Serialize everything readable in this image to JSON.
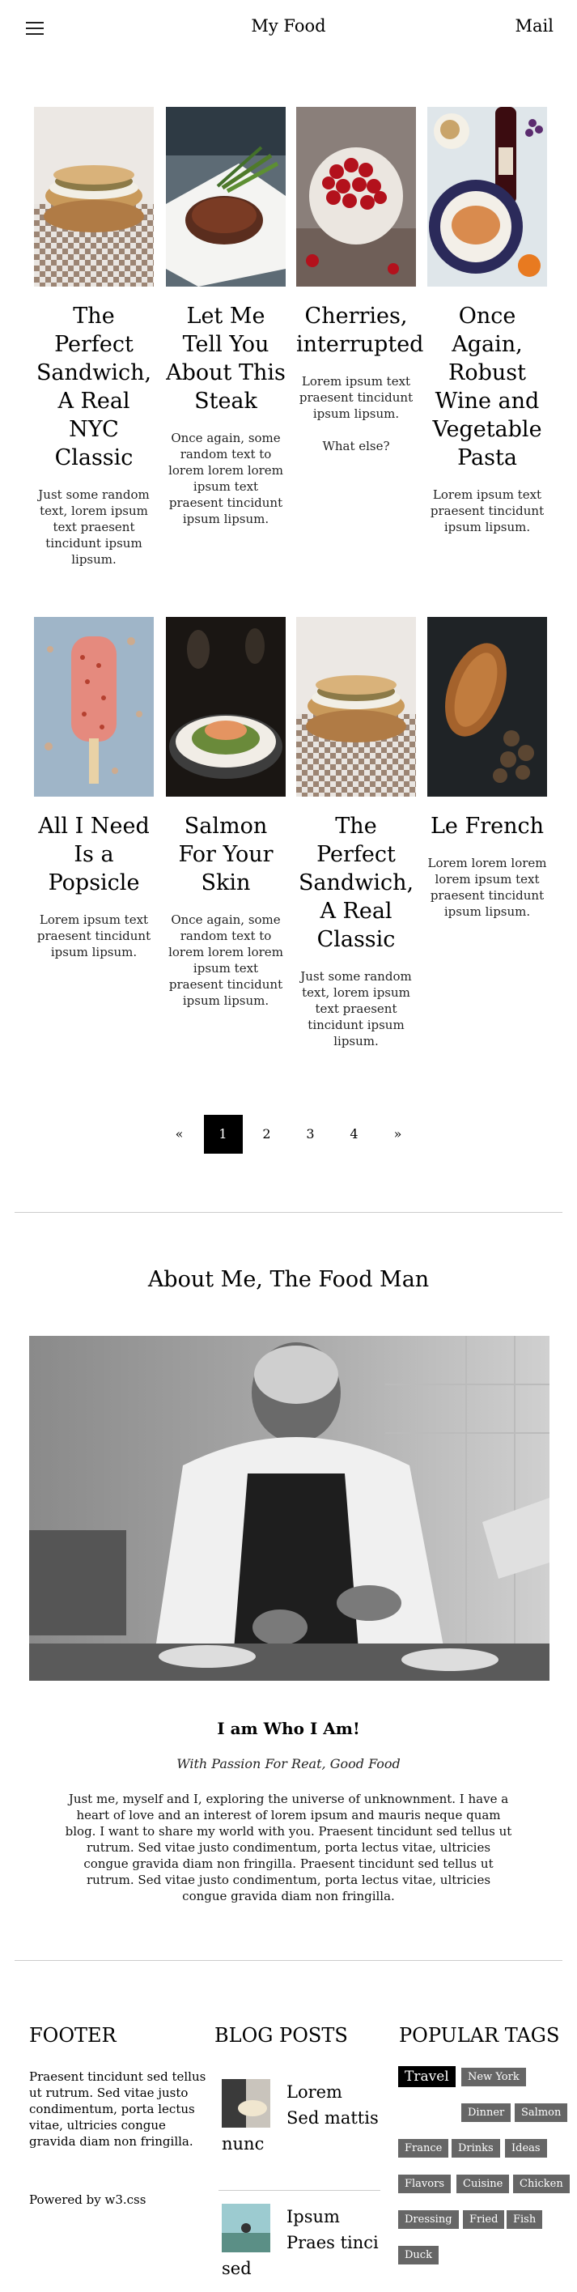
{
  "header": {
    "menu_icon": "hamburger-menu-icon",
    "title": "My Food",
    "mail": "Mail"
  },
  "cards": [
    {
      "title": "The Perfect Sandwich, A Real NYC Classic",
      "text": "Just some random text, lorem ipsum text praesent tincidunt ipsum lipsum.",
      "extra": ""
    },
    {
      "title": "Let Me Tell You About This Steak",
      "text": "Once again, some random text to lorem lorem lorem ipsum text praesent tincidunt ipsum lipsum.",
      "extra": ""
    },
    {
      "title": "Cherries, interrupted",
      "text": "Lorem ipsum text praesent tincidunt ipsum lipsum.",
      "extra": "What else?"
    },
    {
      "title": "Once Again, Robust Wine and Vegetable Pasta",
      "text": "Lorem ipsum text praesent tincidunt ipsum lipsum.",
      "extra": ""
    },
    {
      "title": "All I Need Is a Popsicle",
      "text": "Lorem ipsum text praesent tincidunt ipsum lipsum.",
      "extra": ""
    },
    {
      "title": "Salmon For Your Skin",
      "text": "Once again, some random text to lorem lorem lorem ipsum text praesent tincidunt ipsum lipsum.",
      "extra": ""
    },
    {
      "title": "The Perfect Sandwich, A Real Classic",
      "text": "Just some random text, lorem ipsum text praesent tincidunt ipsum lipsum.",
      "extra": ""
    },
    {
      "title": "Le French",
      "text": "Lorem lorem lorem lorem ipsum text praesent tincidunt ipsum lipsum.",
      "extra": ""
    }
  ],
  "pagination": {
    "prev": "«",
    "pages": [
      "1",
      "2",
      "3",
      "4"
    ],
    "next": "»",
    "active": "1"
  },
  "about": {
    "title": "About Me, The Food Man",
    "name": "I am Who I Am!",
    "tagline": "With Passion For Reat, Good Food",
    "body": "Just me, myself and I, exploring the universe of unknownment. I have a heart of love and an interest of lorem ipsum and mauris neque quam blog. I want to share my world with you. Praesent tincidunt sed tellus ut rutrum. Sed vitae justo condimentum, porta lectus vitae, ultricies congue gravida diam non fringilla. Praesent tincidunt sed tellus ut rutrum. Sed vitae justo condimentum, porta lectus vitae, ultricies congue gravida diam non fringilla."
  },
  "footer": {
    "heading": "FOOTER",
    "text": "Praesent tincidunt sed tellus ut rutrum. Sed vitae justo condimentum, porta lectus vitae, ultricies congue gravida diam non fringilla.",
    "powered_prefix": "Powered by ",
    "powered_link": "w3.css"
  },
  "blog_posts": {
    "heading": "BLOG POSTS",
    "posts": [
      {
        "line1": "Lorem",
        "line2": "Sed mattis",
        "line3": "nunc"
      },
      {
        "line1": "Ipsum",
        "line2": "Praes tinci",
        "line3": "sed"
      }
    ]
  },
  "popular_tags": {
    "heading": "POPULAR TAGS",
    "tags": [
      "Travel",
      "New York",
      "Dinner",
      "Salmon",
      "France",
      "Drinks",
      "Ideas",
      "Flavors",
      "Cuisine",
      "Chicken",
      "Dressing",
      "Fried",
      "Fish",
      "Duck"
    ]
  },
  "colors": {
    "active_page": "#000000",
    "tag_bg": "#666666",
    "tag_active_bg": "#000000",
    "divider": "#cccccc"
  }
}
